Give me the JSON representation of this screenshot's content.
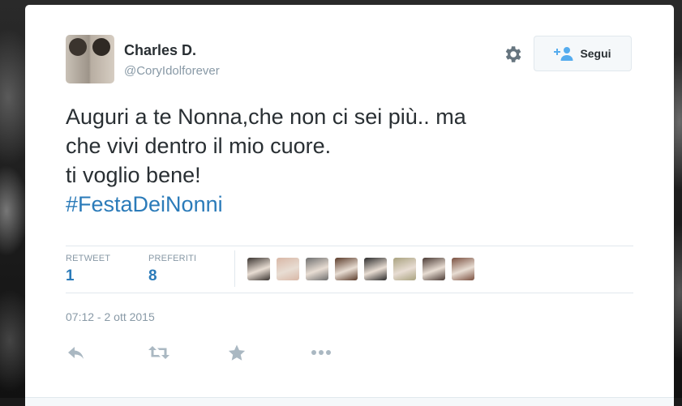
{
  "user": {
    "name": "Charles D.",
    "handle": "@CoryIdolforever"
  },
  "follow_button": {
    "label": "Segui",
    "icon": "add-user-icon"
  },
  "settings_icon": "gear-icon",
  "tweet": {
    "lines": [
      "Auguri a te Nonna,che non ci sei più.. ma",
      "che vivi dentro il mio cuore.",
      "ti voglio bene!"
    ],
    "hashtag": "#FestaDeiNonni"
  },
  "stats": {
    "retweet_label": "RETWEET",
    "retweet_count": "1",
    "favorites_label": "PREFERITI",
    "favorites_count": "8"
  },
  "favorited_by_avatar_colors": [
    "#3a3430",
    "#d8b7a6",
    "#6e6e6e",
    "#5a3b2a",
    "#2b2b2b",
    "#a9a27f",
    "#4a3a34",
    "#7a4f3f"
  ],
  "timestamp": "07:12 - 2 ott 2015",
  "actions": [
    "reply-icon",
    "retweet-icon",
    "favorite-icon",
    "more-icon"
  ],
  "colors": {
    "link": "#2b7bb9",
    "text": "#292f33",
    "muted": "#8899a6"
  }
}
